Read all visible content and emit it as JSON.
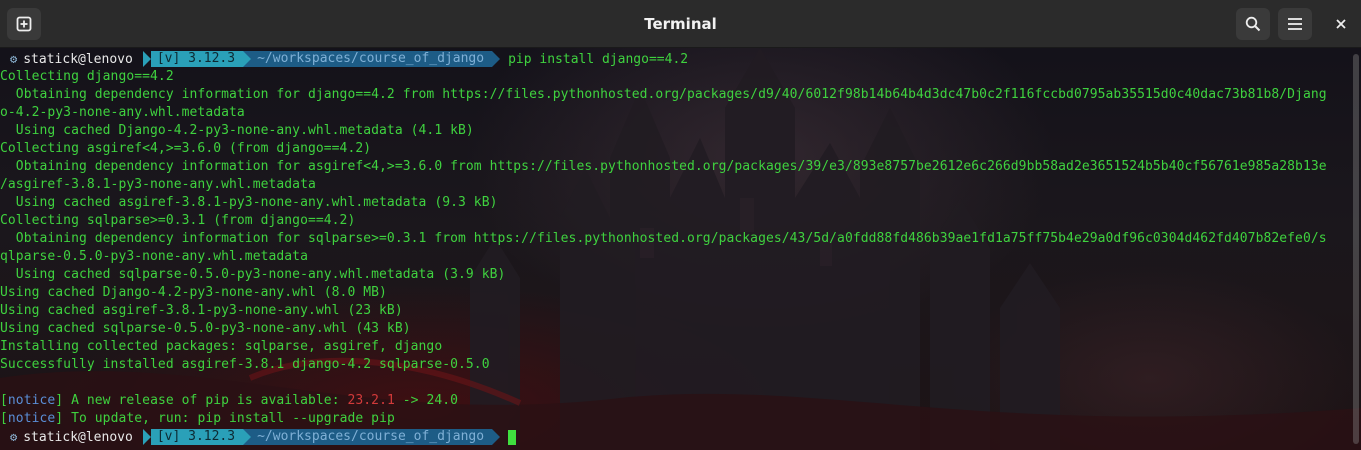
{
  "window": {
    "title": "Terminal",
    "icons": {
      "new_tab": "new-tab-icon",
      "search": "search-icon",
      "menu": "hamburger-menu-icon",
      "close": "close-icon"
    }
  },
  "prompt": {
    "user": "statick@lenovo",
    "venv": "[v] 3.12.3",
    "path": "~/workspaces/course_of_django",
    "command": "pip install django==4.2"
  },
  "output": [
    "Collecting django==4.2",
    "  Obtaining dependency information for django==4.2 from https://files.pythonhosted.org/packages/d9/40/6012f98b14b64b4d3dc47b0c2f116fccbd0795ab35515d0c40dac73b81b8/Djang",
    "o-4.2-py3-none-any.whl.metadata",
    "  Using cached Django-4.2-py3-none-any.whl.metadata (4.1 kB)",
    "Collecting asgiref<4,>=3.6.0 (from django==4.2)",
    "  Obtaining dependency information for asgiref<4,>=3.6.0 from https://files.pythonhosted.org/packages/39/e3/893e8757be2612e6c266d9bb58ad2e3651524b5b40cf56761e985a28b13e",
    "/asgiref-3.8.1-py3-none-any.whl.metadata",
    "  Using cached asgiref-3.8.1-py3-none-any.whl.metadata (9.3 kB)",
    "Collecting sqlparse>=0.3.1 (from django==4.2)",
    "  Obtaining dependency information for sqlparse>=0.3.1 from https://files.pythonhosted.org/packages/43/5d/a0fdd88fd486b39ae1fd1a75ff75b4e29a0df96c0304d462fd407b82efe0/s",
    "qlparse-0.5.0-py3-none-any.whl.metadata",
    "  Using cached sqlparse-0.5.0-py3-none-any.whl.metadata (3.9 kB)",
    "Using cached Django-4.2-py3-none-any.whl (8.0 MB)",
    "Using cached asgiref-3.8.1-py3-none-any.whl (23 kB)",
    "Using cached sqlparse-0.5.0-py3-none-any.whl (43 kB)",
    "Installing collected packages: sqlparse, asgiref, django",
    "Successfully installed asgiref-3.8.1 django-4.2 sqlparse-0.5.0",
    ""
  ],
  "notice1": {
    "tag": "notice",
    "text": " A new release of pip is available: ",
    "old_version": "23.2.1",
    "arrow": " -> ",
    "new_version": "24.0"
  },
  "notice2": {
    "tag": "notice",
    "text": " To update, run: ",
    "command": "pip install --upgrade pip"
  },
  "colors": {
    "output_green": "#3fd23f",
    "venv_segment": "#2aa0b8",
    "path_segment": "#1d5c86",
    "notice_blue": "#5a8ed6",
    "old_version_red": "#d23a3a"
  }
}
